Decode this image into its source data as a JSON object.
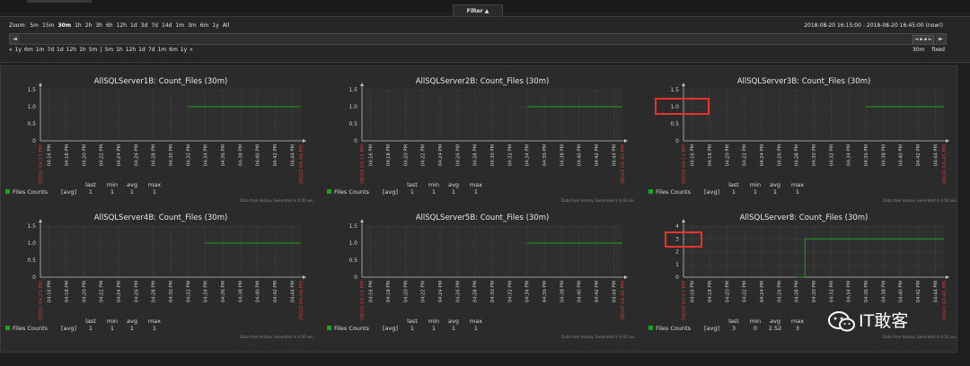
{
  "filter": {
    "tab_label": "Filter ▲"
  },
  "zoom": {
    "label": "Zoom:",
    "options": [
      "5m",
      "15m",
      "30m",
      "1h",
      "2h",
      "3h",
      "6h",
      "12h",
      "1d",
      "3d",
      "7d",
      "14d",
      "1m",
      "3m",
      "6m",
      "1y",
      "All"
    ],
    "selected": "30m"
  },
  "time_range": "2018-08-20 16:15:00 - 2018-08-20 16:45:00 (now!)",
  "scroll": {
    "left": "◄",
    "right": "►",
    "thumb": "◄ ▪ ▪ ►"
  },
  "period_nav": [
    "«",
    "1y",
    "6m",
    "1m",
    "7d",
    "1d",
    "12h",
    "1h",
    "5m",
    "|",
    "5m",
    "1h",
    "12h",
    "1d",
    "7d",
    "1m",
    "6m",
    "1y",
    "»"
  ],
  "period_right": {
    "period": "30m",
    "mode": "fixed"
  },
  "x_ticks": [
    "04:16 PM",
    "04:18 PM",
    "04:20 PM",
    "04:22 PM",
    "04:24 PM",
    "04:26 PM",
    "04:28 PM",
    "04:30 PM",
    "04:32 PM",
    "04:34 PM",
    "04:36 PM",
    "04:38 PM",
    "04:40 PM",
    "04:42 PM",
    "04:44 PM"
  ],
  "x_start": "08/20 04:15 PM",
  "x_end": "08/20 04:45 PM",
  "legend_headers": [
    "last",
    "min",
    "avg",
    "max"
  ],
  "footer_note": "Data from history. Generated in 0.02 sec.",
  "colors": {
    "line": "#1fa21f",
    "accent_red": "#c43b3b",
    "highlight": "#e8342c"
  },
  "chart_data": [
    {
      "type": "line",
      "title": "AllSQLServer1B: Count_Files (30m)",
      "ylim": [
        0,
        1.5
      ],
      "yticks": [
        "0",
        "0.5",
        "1.0",
        "1.5"
      ],
      "x": [
        "04:32 PM",
        "04:45 PM"
      ],
      "y": [
        1,
        1
      ],
      "legend": {
        "name": "Files Counts",
        "fn": "[avg]",
        "last": "1",
        "min": "1",
        "avg": "1",
        "max": "1"
      }
    },
    {
      "type": "line",
      "title": "AllSQLServer2B: Count_Files (30m)",
      "ylim": [
        0,
        1.5
      ],
      "yticks": [
        "0",
        "0.5",
        "1.0",
        "1.5"
      ],
      "x": [
        "04:34 PM",
        "04:45 PM"
      ],
      "y": [
        1,
        1
      ],
      "legend": {
        "name": "Files Counts",
        "fn": "[avg]",
        "last": "1",
        "min": "1",
        "avg": "1",
        "max": "1"
      }
    },
    {
      "type": "line",
      "title": "AllSQLServer3B: Count_Files (30m)",
      "ylim": [
        0,
        1.5
      ],
      "yticks": [
        "0",
        "0.5",
        "1.0",
        "1.5"
      ],
      "x": [
        "04:36 PM",
        "04:45 PM"
      ],
      "y": [
        1,
        1
      ],
      "legend": {
        "name": "Files Counts",
        "fn": "[avg]",
        "last": "1",
        "min": "1",
        "avg": "1",
        "max": "1"
      }
    },
    {
      "type": "line",
      "title": "AllSQLServer4B: Count_Files (30m)",
      "ylim": [
        0,
        1.5
      ],
      "yticks": [
        "0",
        "0.5",
        "1.0",
        "1.5"
      ],
      "x": [
        "04:34 PM",
        "04:45 PM"
      ],
      "y": [
        1,
        1
      ],
      "legend": {
        "name": "Files Counts",
        "fn": "[avg]",
        "last": "1",
        "min": "1",
        "avg": "1",
        "max": "1"
      }
    },
    {
      "type": "line",
      "title": "AllSQLServer5B: Count_Files (30m)",
      "ylim": [
        0,
        1.5
      ],
      "yticks": [
        "0",
        "0.5",
        "1.0",
        "1.5"
      ],
      "x": [
        "04:34 PM",
        "04:45 PM"
      ],
      "y": [
        1,
        1
      ],
      "legend": {
        "name": "Files Counts",
        "fn": "[avg]",
        "last": "1",
        "min": "1",
        "avg": "1",
        "max": "1"
      }
    },
    {
      "type": "line",
      "title": "AllSQLServer8: Count_Files (30m)",
      "ylim": [
        0,
        4
      ],
      "yticks": [
        "0",
        "1",
        "2",
        "3",
        "4"
      ],
      "x": [
        "04:28 PM",
        "04:29 PM",
        "04:29 PM",
        "04:45 PM"
      ],
      "y": [
        0,
        0,
        3,
        3
      ],
      "legend": {
        "name": "Files Counts",
        "fn": "[avg]",
        "last": "3",
        "min": "0",
        "avg": "2.52",
        "max": "3"
      }
    }
  ],
  "watermark": {
    "text": "IT敢客"
  }
}
